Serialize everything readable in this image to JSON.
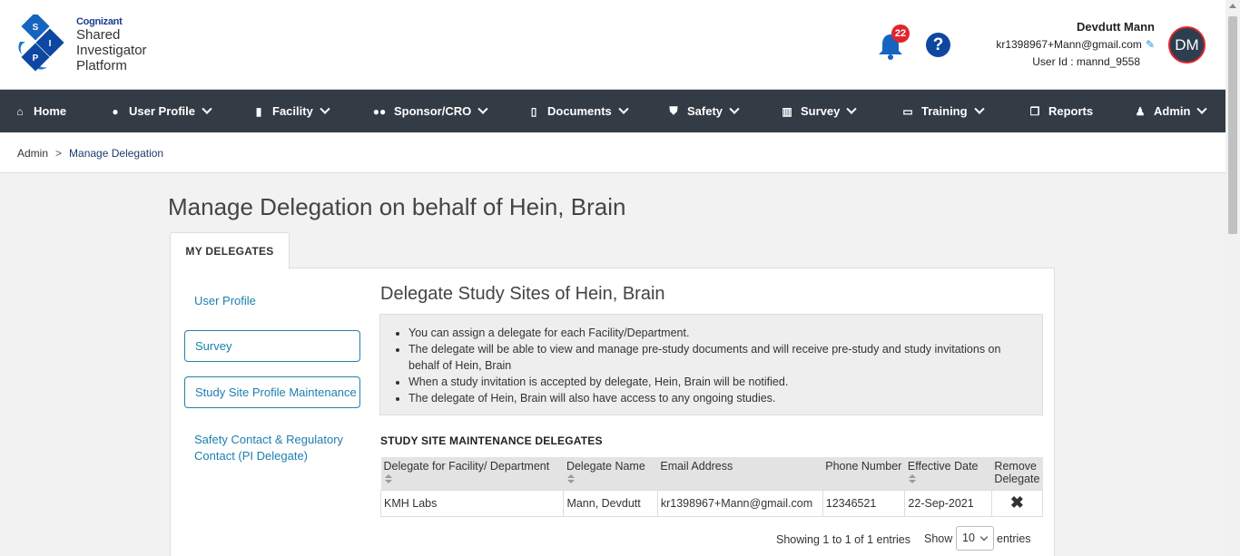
{
  "logo": {
    "brand": "Cognizant",
    "line1": "Shared",
    "line2": "Investigator",
    "line3": "Platform",
    "letters": [
      "S",
      "I",
      "P"
    ]
  },
  "header": {
    "notification_count": "22",
    "help_icon": "?",
    "user_name": "Devdutt Mann",
    "user_email": "kr1398967+Mann@gmail.com",
    "user_id": "User Id : mannd_9558",
    "avatar_initials": "DM"
  },
  "nav": [
    {
      "label": "Home",
      "icon": "home-icon"
    },
    {
      "label": "User Profile",
      "icon": "user-circle-icon"
    },
    {
      "label": "Facility",
      "icon": "building-icon"
    },
    {
      "label": "Sponsor/CRO",
      "icon": "users-icon"
    },
    {
      "label": "Documents",
      "icon": "file-icon"
    },
    {
      "label": "Safety",
      "icon": "shield-icon"
    },
    {
      "label": "Survey",
      "icon": "bar-chart-icon"
    },
    {
      "label": "Training",
      "icon": "laptop-icon"
    },
    {
      "label": "Reports",
      "icon": "copy-icon"
    },
    {
      "label": "Admin",
      "icon": "user-icon"
    }
  ],
  "breadcrumb": {
    "root": "Admin",
    "sep": ">",
    "current": "Manage Delegation"
  },
  "page_title": "Manage Delegation on behalf of Hein, Brain",
  "tab_label": "MY DELEGATES",
  "sidebar": {
    "user_profile": "User Profile",
    "survey": "Survey",
    "study_site": "Study Site Profile Maintenance",
    "safety_line1": "Safety Contact & Regulatory",
    "safety_line2": "Contact (PI Delegate)"
  },
  "section_title": "Delegate Study Sites of Hein, Brain",
  "info": [
    "You can assign a delegate for each Facility/Department.",
    "The delegate will be able to view and manage pre-study documents and will receive pre-study and study invitations on behalf of Hein, Brain",
    "When a study invitation is accepted by delegate, Hein, Brain will be notified.",
    "The delegate of Hein, Brain will also have access to any ongoing studies."
  ],
  "table_title": "STUDY SITE MAINTENANCE DELEGATES",
  "table": {
    "headers": [
      "Delegate for Facility/ Department",
      "Delegate Name",
      "Email Address",
      "Phone Number",
      "Effective Date",
      "Remove Delegate"
    ],
    "rows": [
      {
        "facility": "KMH Labs",
        "name": "Mann, Devdutt",
        "email": "kr1398967+Mann@gmail.com",
        "phone": "12346521",
        "date": "22-Sep-2021",
        "remove": "✖"
      }
    ]
  },
  "pagination": {
    "showing": "Showing 1 to 1 of 1 entries",
    "show": "Show",
    "page_size": "10",
    "entries": "entries"
  },
  "colors": {
    "nav_bg": "#333b45",
    "accent": "#1b7fb0",
    "badge": "#e0242c",
    "help": "#0d47a1"
  }
}
